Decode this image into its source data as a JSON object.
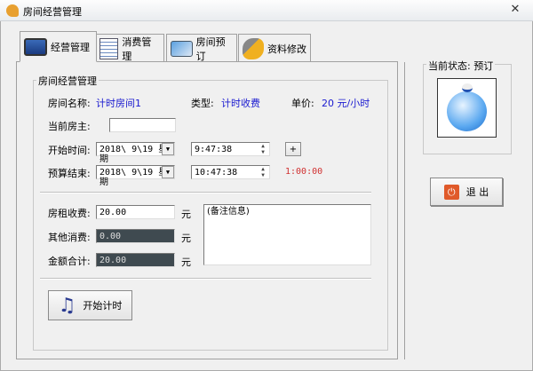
{
  "window": {
    "title": "房间经营管理",
    "close": "✕"
  },
  "tabs": [
    {
      "label": "经营管理",
      "icon": "monitor-icon"
    },
    {
      "label": "消费管理",
      "icon": "document-pencil-icon"
    },
    {
      "label": "房间预订",
      "icon": "card-icon"
    },
    {
      "label": "资料修改",
      "icon": "wrench-icon"
    }
  ],
  "main": {
    "group_title": "房间经营管理",
    "room_name_label": "房间名称:",
    "room_name": "计时房间1",
    "type_label": "类型:",
    "type": "计时收费",
    "price_label": "单价:",
    "price": "20 元/小时",
    "owner_label": "当前房主:",
    "owner_value": "",
    "start_label": "开始时间:",
    "start_date": "2018\\ 9\\19 星期",
    "start_time": "9:47:38",
    "plus": "+",
    "end_label": "预算结束:",
    "end_date": "2018\\ 9\\19 星期",
    "end_time": "10:47:38",
    "duration": "1:00:00",
    "rent_label": "房租收费:",
    "rent": "20.00",
    "other_label": "其他消费:",
    "other": "0.00",
    "total_label": "金额合计:",
    "total": "20.00",
    "yuan": "元",
    "memo": "(备注信息)",
    "start_button": "开始计时"
  },
  "status": {
    "title": "当前状态: 预订",
    "exit": "退 出"
  },
  "colors": {
    "blue": "#1a1ad0",
    "red": "#d03030"
  }
}
